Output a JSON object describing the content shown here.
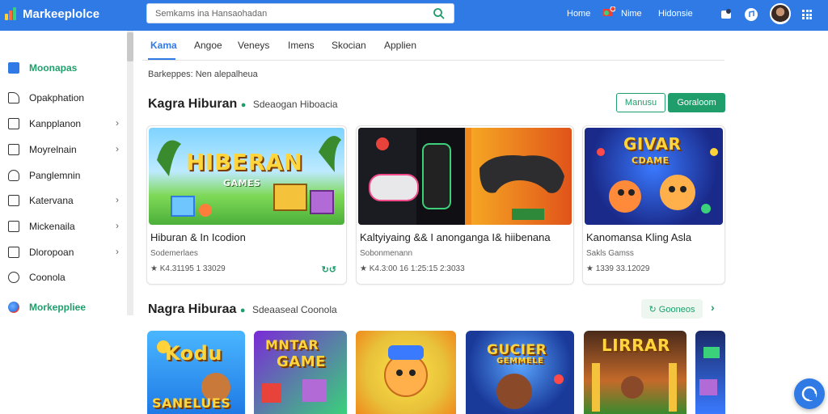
{
  "header": {
    "logo": "Markeeplolce",
    "search_placeholder": "Semkams ina Hansaohadan",
    "nav": [
      "Home",
      "Nime",
      "Hidonsie"
    ]
  },
  "sidebar": {
    "items": [
      {
        "label": "Moonapas",
        "active": true,
        "chevron": false
      },
      {
        "label": "Opakphation",
        "active": false,
        "chevron": false
      },
      {
        "label": "Kanpplanon",
        "active": false,
        "chevron": true
      },
      {
        "label": "Moyrelnain",
        "active": false,
        "chevron": true
      },
      {
        "label": "Panglemnin",
        "active": false,
        "chevron": false
      },
      {
        "label": "Katervana",
        "active": false,
        "chevron": true
      },
      {
        "label": "Mickenaila",
        "active": false,
        "chevron": true
      },
      {
        "label": "Dloropoan",
        "active": false,
        "chevron": true
      },
      {
        "label": "Coonola",
        "active": false,
        "chevron": false
      },
      {
        "label": "Morkeppliee",
        "active": true,
        "chevron": false
      }
    ]
  },
  "tabs": [
    "Kama",
    "Angoe",
    "Veneys",
    "Imens",
    "Skocian",
    "Applien"
  ],
  "breadcrumb": "Barkeppes: Nen alepalheua",
  "section1": {
    "title": "Kagra Hiburan",
    "subtitle": "Sdeaogan Hiboacia",
    "btn_outline": "Manusu",
    "btn_filled": "Goraloom"
  },
  "cards": [
    {
      "title": "Hiburan & In Icodion",
      "sub": "Sodemerlaes",
      "meta": "★ K4.31195 1 33029",
      "badge": "↻↺",
      "banner": "HIBERAN",
      "banner_sub": "GAMES"
    },
    {
      "title": "Kaltyiyaing && I anonganga I& hiibenana",
      "sub": "Sobonmenann",
      "meta": "★ K4.3:00 16 1:25:15 2:3033",
      "badge": "",
      "banner": "",
      "banner_sub": ""
    },
    {
      "title": "Kanomansa Kling Asla",
      "sub": "Sakls Gamss",
      "meta": "★ 1339 33.12029",
      "badge": "",
      "banner": "GIVAR",
      "banner_sub": "CDAME"
    }
  ],
  "section2": {
    "title": "Nagra Hiburaa",
    "subtitle": "Sdeaaseal Coonola",
    "btn": "↻ Gooneos",
    "arrow": "›"
  },
  "tiles": [
    {
      "text": "Kodu",
      "text2": "SANELUES"
    },
    {
      "text": "MNTAR",
      "text2": "GAME"
    },
    {
      "text": "",
      "text2": ""
    },
    {
      "text": "GUCIER",
      "text2": "GEMMELE"
    },
    {
      "text": "LIRRAR",
      "text2": ""
    },
    {
      "text": "",
      "text2": ""
    }
  ]
}
